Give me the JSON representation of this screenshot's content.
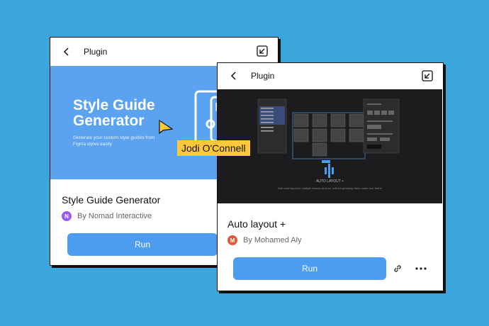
{
  "card_left": {
    "header_title": "Plugin",
    "banner_title": "Style Guide Generator",
    "banner_subtitle": "Generate your custom style guides from Figma styles easily",
    "plugin_name": "Style Guide Generator",
    "author_initial": "N",
    "author": "By Nomad Interactive",
    "run_label": "Run",
    "avatar_color": "#9a5cf0",
    "banner_color": "#5ba3f0"
  },
  "card_right": {
    "header_title": "Plugin",
    "banner_text": "AUTO LAYOUT +",
    "banner_caption": "Add auto layout to multiple frames at once, without grouping them under one frame",
    "plugin_name": "Auto layout +",
    "author_initial": "M",
    "author": "By Mohamed Aly",
    "run_label": "Run",
    "avatar_color": "#e0573a",
    "banner_color": "#1c1c1e"
  },
  "cursor": {
    "user_name": "Jodi O'Connell",
    "color": "#ffc83a"
  },
  "colors": {
    "background": "#3aa6db",
    "run_button": "#4c9cf0"
  },
  "icons": [
    "chevron-left-icon",
    "expand-icon",
    "link-icon",
    "more-icon",
    "cursor-icon"
  ]
}
